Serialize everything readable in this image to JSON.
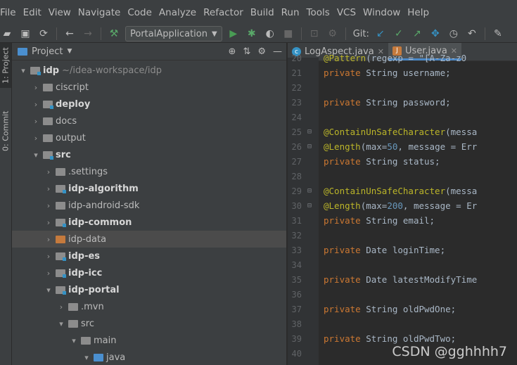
{
  "menu": [
    "File",
    "Edit",
    "View",
    "Navigate",
    "Code",
    "Analyze",
    "Refactor",
    "Build",
    "Run",
    "Tools",
    "VCS",
    "Window",
    "Help"
  ],
  "toolbar": {
    "run_config": "PortalApplication",
    "git_label": "Git:"
  },
  "left_tabs": {
    "project": "1: Project",
    "commit": "0: Commit"
  },
  "project_panel": {
    "title": "Project",
    "tree": [
      {
        "label": "idp",
        "suffix": "~/idea-workspace/idp"
      },
      {
        "label": "ciscript"
      },
      {
        "label": "deploy"
      },
      {
        "label": "docs"
      },
      {
        "label": "output"
      },
      {
        "label": "src"
      },
      {
        "label": ".settings"
      },
      {
        "label": "idp-algorithm"
      },
      {
        "label": "idp-android-sdk"
      },
      {
        "label": "idp-common"
      },
      {
        "label": "idp-data"
      },
      {
        "label": "idp-es"
      },
      {
        "label": "idp-icc"
      },
      {
        "label": "idp-portal"
      },
      {
        "label": ".mvn"
      },
      {
        "label": "src"
      },
      {
        "label": "main"
      },
      {
        "label": "java"
      }
    ]
  },
  "editor": {
    "tabs": [
      {
        "label": "LogAspect.java"
      },
      {
        "label": "User.java"
      }
    ],
    "lines": [
      {
        "n": "20",
        "t": "@Pattern(regexp = \"[A-Za-z0"
      },
      {
        "n": "21",
        "t": "private String username;"
      },
      {
        "n": "22",
        "t": ""
      },
      {
        "n": "23",
        "t": "private String password;"
      },
      {
        "n": "24",
        "t": ""
      },
      {
        "n": "25",
        "t": "@ContainUnSafeCharacter(messa"
      },
      {
        "n": "26",
        "t": "@Length(max=50, message = Err"
      },
      {
        "n": "27",
        "t": "private String status;"
      },
      {
        "n": "28",
        "t": ""
      },
      {
        "n": "29",
        "t": "@ContainUnSafeCharacter(messa"
      },
      {
        "n": "30",
        "t": "@Length(max=200, message = Er"
      },
      {
        "n": "31",
        "t": "private String email;"
      },
      {
        "n": "32",
        "t": ""
      },
      {
        "n": "33",
        "t": "private Date loginTime;"
      },
      {
        "n": "34",
        "t": ""
      },
      {
        "n": "35",
        "t": "private Date latestModifyTime"
      },
      {
        "n": "36",
        "t": ""
      },
      {
        "n": "37",
        "t": "private String oldPwdOne;"
      },
      {
        "n": "38",
        "t": ""
      },
      {
        "n": "39",
        "t": "private String oldPwdTwo;"
      },
      {
        "n": "40",
        "t": ""
      }
    ]
  },
  "watermark": "CSDN @gghhhh7"
}
